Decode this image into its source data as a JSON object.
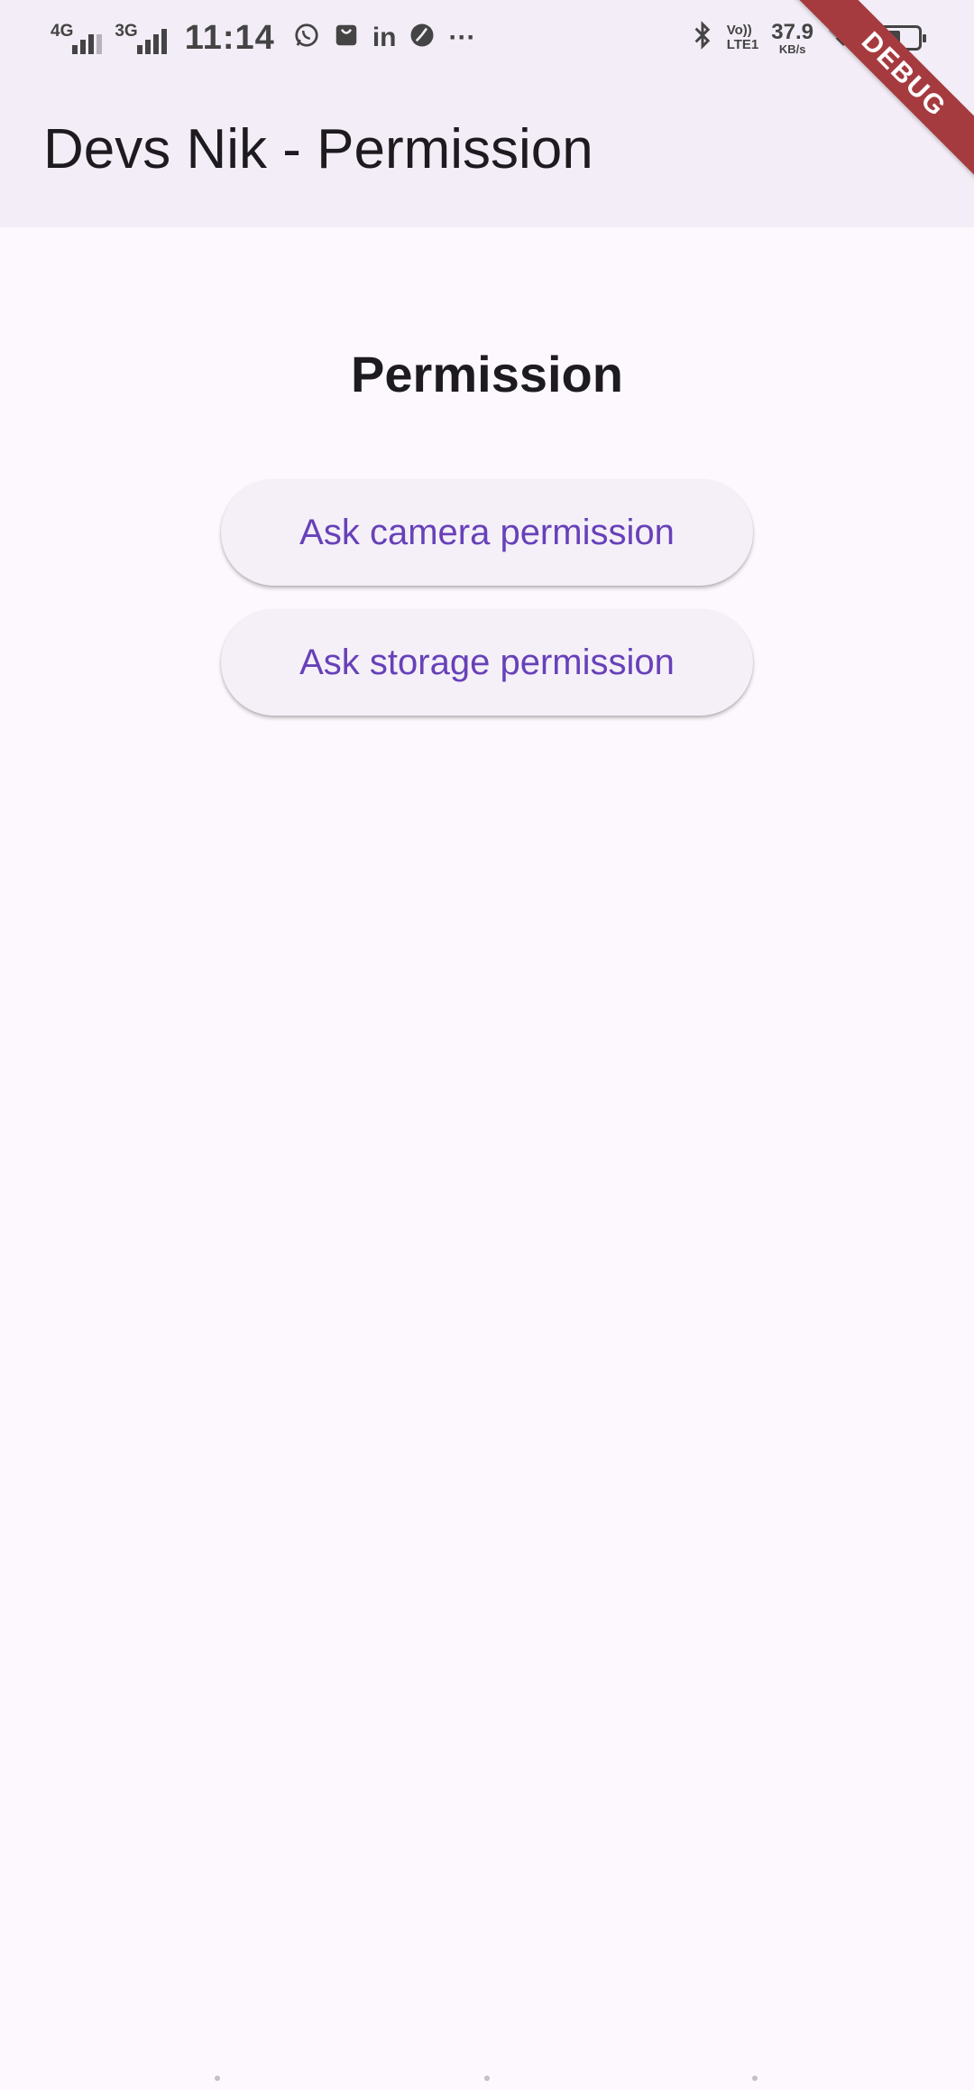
{
  "status_bar": {
    "network1_label": "4G",
    "network2_label": "3G",
    "time": "11:14",
    "notification_icons": [
      "whatsapp-icon",
      "shopping-bag-icon",
      "linkedin-icon",
      "leaf-icon",
      "more-icon"
    ],
    "linkedin_text": "in",
    "more_text": "···",
    "volte_line1": "Vo))",
    "volte_line2": "LTE1",
    "speed_value": "37.9",
    "speed_unit": "KB/s",
    "battery_level": 0.62
  },
  "app_bar": {
    "title": "Devs Nik - Permission"
  },
  "main": {
    "heading": "Permission",
    "buttons": [
      {
        "label": "Ask camera permission"
      },
      {
        "label": "Ask storage permission"
      }
    ]
  },
  "debug_banner": {
    "label": "DEBUG"
  },
  "colors": {
    "app_bar_bg": "#f3edf7",
    "page_bg": "#fdf8fd",
    "button_text": "#6741b8",
    "debug_banner": "#a63b3f"
  }
}
